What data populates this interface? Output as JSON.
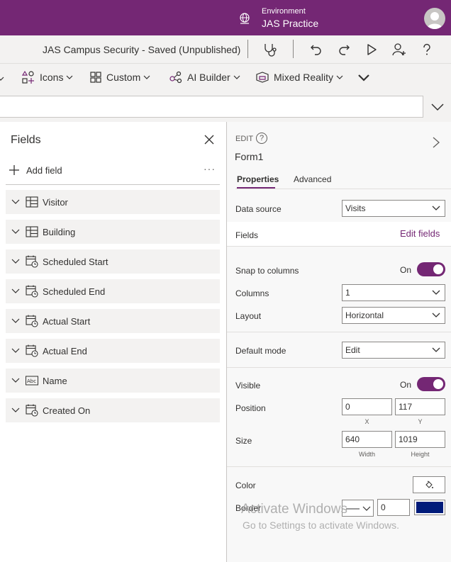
{
  "header": {
    "environment_label": "Environment",
    "environment_name": "JAS Practice"
  },
  "titlebar": {
    "app_title": "JAS Campus Security - Saved (Unpublished)"
  },
  "ribbon": {
    "icons_label": "Icons",
    "custom_label": "Custom",
    "ai_builder_label": "AI Builder",
    "mixed_reality_label": "Mixed Reality"
  },
  "fields_pane": {
    "title": "Fields",
    "add_field_label": "Add field",
    "more_label": "···",
    "fields": [
      {
        "label": "Visitor",
        "icon": "lookup-icon"
      },
      {
        "label": "Building",
        "icon": "lookup-icon"
      },
      {
        "label": "Scheduled Start",
        "icon": "datetime-icon"
      },
      {
        "label": "Scheduled End",
        "icon": "datetime-icon"
      },
      {
        "label": "Actual Start",
        "icon": "datetime-icon"
      },
      {
        "label": "Actual End",
        "icon": "datetime-icon"
      },
      {
        "label": "Name",
        "icon": "text-icon"
      },
      {
        "label": "Created On",
        "icon": "datetime-icon"
      }
    ]
  },
  "properties_pane": {
    "edit_label": "EDIT",
    "help_label": "?",
    "form_name": "Form1",
    "tabs": {
      "properties": "Properties",
      "advanced": "Advanced"
    },
    "data_source_label": "Data source",
    "data_source_value": "Visits",
    "fields_label": "Fields",
    "edit_fields_label": "Edit fields",
    "snap_label": "Snap to columns",
    "snap_state": "On",
    "columns_label": "Columns",
    "columns_value": "1",
    "layout_label": "Layout",
    "layout_value": "Horizontal",
    "default_mode_label": "Default mode",
    "default_mode_value": "Edit",
    "visible_label": "Visible",
    "visible_state": "On",
    "position_label": "Position",
    "position_x": "0",
    "position_y": "117",
    "x_caption": "X",
    "y_caption": "Y",
    "size_label": "Size",
    "size_width": "640",
    "size_height": "1019",
    "width_caption": "Width",
    "height_caption": "Height",
    "color_label": "Color",
    "border_label": "Border",
    "border_width": "0",
    "border_color": "#001b7a"
  },
  "watermark": {
    "title": "Activate Windows",
    "subtitle": "Go to Settings to activate Windows."
  },
  "colors": {
    "brand": "#742774",
    "toggle_on": "#742774",
    "link": "#742774"
  }
}
